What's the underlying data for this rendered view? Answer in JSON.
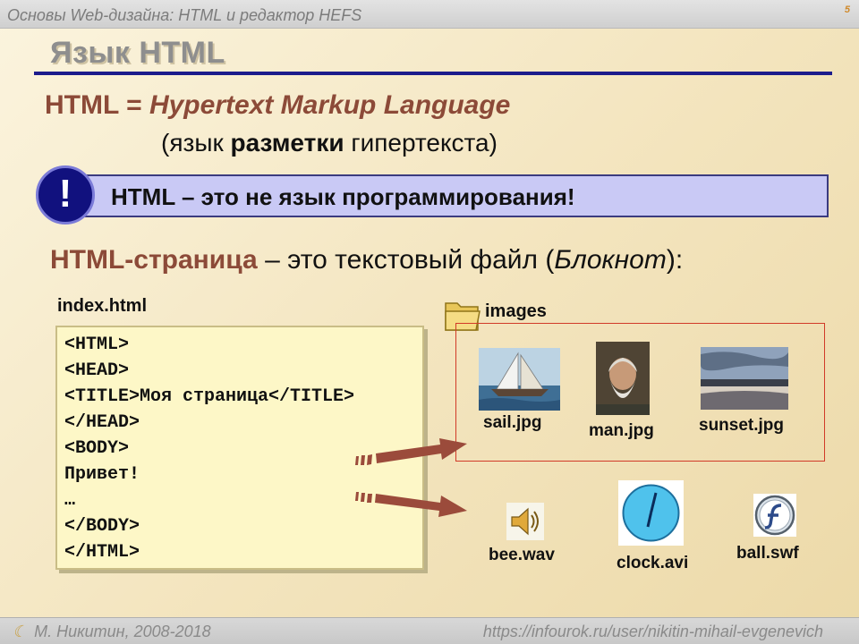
{
  "header": {
    "title": "Основы Web-дизайна: HTML и редактор HEFS",
    "slide_number": "5"
  },
  "slide": {
    "heading": "Язык HTML",
    "definition": {
      "abbr": "HTML = ",
      "expansion": "Hypertext Markup Language",
      "translation_open": "(язык ",
      "translation_bold": "разметки",
      "translation_close": " гипертекста)"
    },
    "alert": {
      "mark": "!",
      "text": "HTML – это не язык программирования!"
    },
    "page_sentence": {
      "highlight": "HTML-страница",
      "middle": " – это текстовый файл (",
      "italic": "Блокнот",
      "end": "):"
    },
    "code": {
      "filename": "index.html",
      "lines": [
        "<HTML>",
        "<HEAD>",
        "<TITLE>Моя страница</TITLE>",
        "</HEAD>",
        "<BODY>",
        "Привет!",
        "…",
        "</BODY>",
        "</HTML>"
      ]
    },
    "folder": {
      "label": "images",
      "icon": "folder-icon",
      "files": [
        {
          "name": "sail.jpg",
          "icon": "sailboat-photo"
        },
        {
          "name": "man.jpg",
          "icon": "portrait-photo"
        },
        {
          "name": "sunset.jpg",
          "icon": "sunset-photo"
        }
      ]
    },
    "media": [
      {
        "name": "bee.wav",
        "icon": "speaker-icon"
      },
      {
        "name": "clock.avi",
        "icon": "clock-video-icon"
      },
      {
        "name": "ball.swf",
        "icon": "flash-icon"
      }
    ]
  },
  "footer": {
    "author": "М. Никитин, 2008-2018",
    "url": "https://infourok.ru/user/nikitin-mihail-evgenevich"
  },
  "colors": {
    "accent_brown": "#8c4a38",
    "rule_blue": "#1c1c8c",
    "alert_fill": "#c9c9f5",
    "code_fill": "#fdf7c7",
    "frame_red": "#d13a28"
  }
}
